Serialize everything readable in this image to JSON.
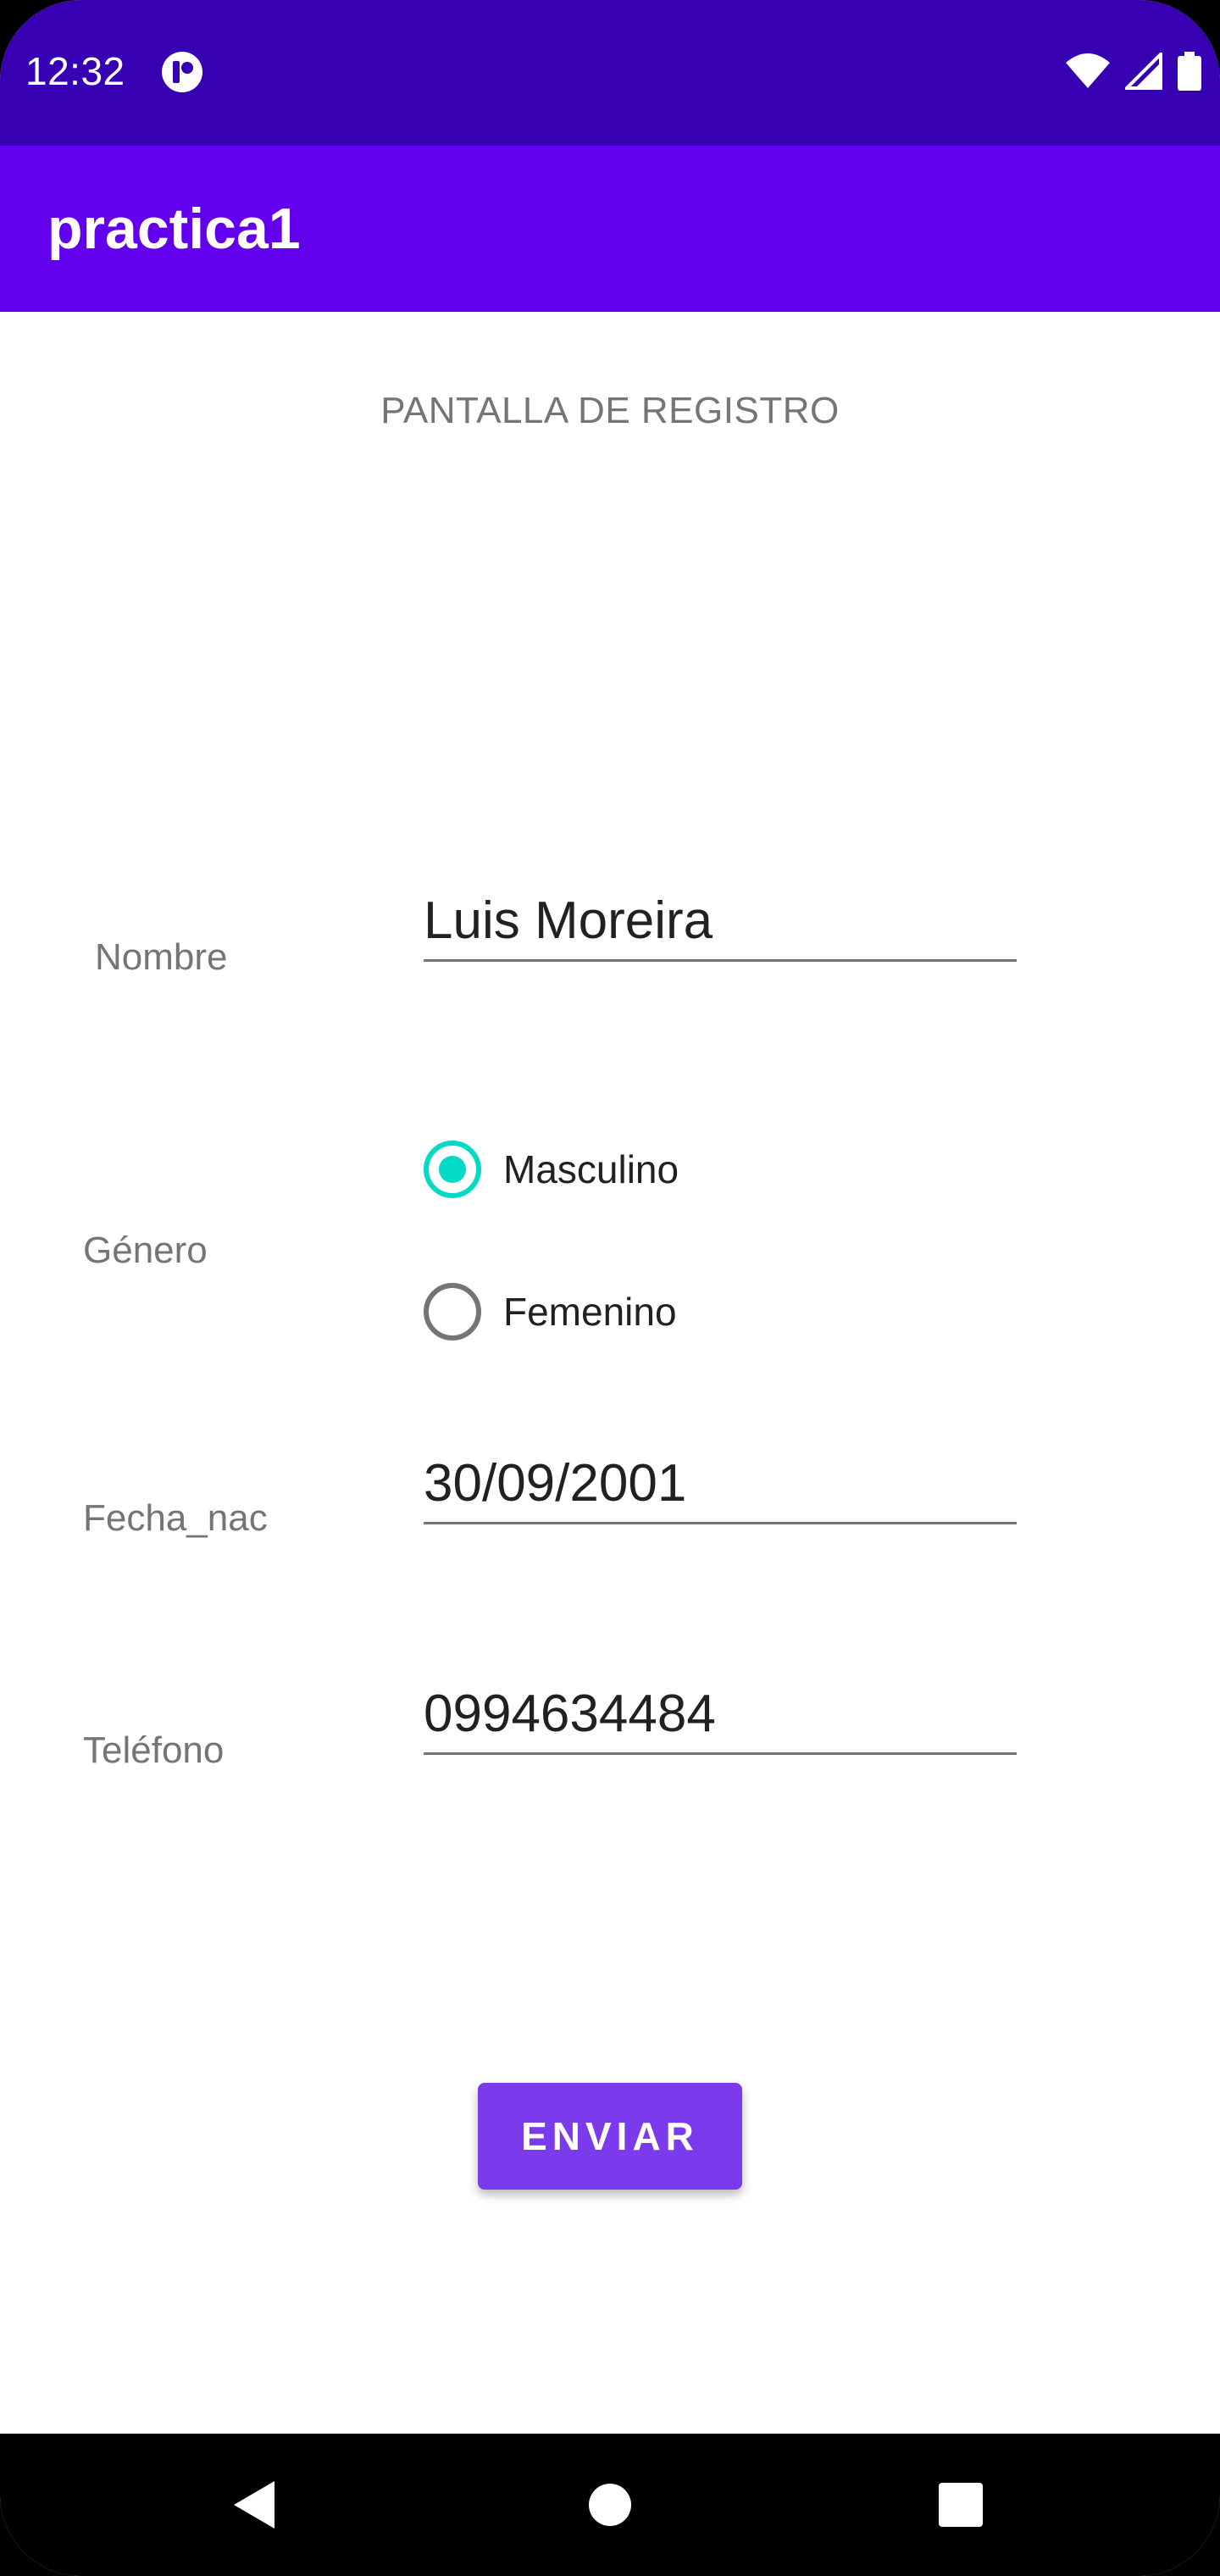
{
  "status_bar": {
    "time": "12:32",
    "background_color": "#3700b3",
    "icons": [
      "app-notification-icon",
      "wifi-icon",
      "cellular-signal-icon",
      "battery-icon"
    ]
  },
  "app_bar": {
    "title": "practica1",
    "background_color": "#6200ee"
  },
  "form": {
    "header": "PANTALLA DE REGISTRO",
    "name_label": "Nombre",
    "name_value": "Luis Moreira",
    "gender_label": "Género",
    "gender_options": [
      {
        "label": "Masculino",
        "selected": true
      },
      {
        "label": "Femenino",
        "selected": false
      }
    ],
    "birthdate_label": "Fecha_nac",
    "birthdate_value": "30/09/2001",
    "phone_label": "Teléfono",
    "phone_value": "0994634484",
    "submit_label": "ENVIAR",
    "accent_color": "#03dac5",
    "button_color": "#7c3aed"
  },
  "nav_bar": {
    "icons": [
      "back-icon",
      "home-icon",
      "recents-icon"
    ]
  }
}
